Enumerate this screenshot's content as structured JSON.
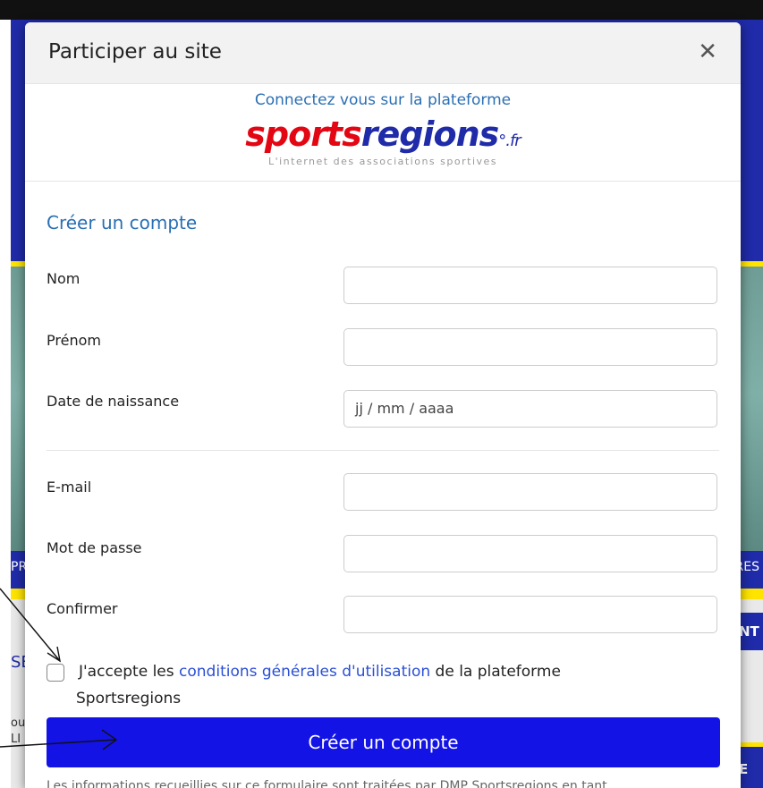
{
  "background": {
    "nav_left": "PR",
    "nav_right": "RES",
    "side_right_1": "NT",
    "side_right_2": "E D",
    "left_heading": "SE",
    "left_text_1": "ou",
    "left_text_2": "LI"
  },
  "modal": {
    "title": "Participer au site",
    "close_icon": "close-icon",
    "brand": {
      "connect_text": "Connectez vous sur la plateforme",
      "logo_part1": "sports",
      "logo_part2": "regions",
      "logo_suffix": "°.fr",
      "tagline": "L'internet des associations sportives"
    },
    "form": {
      "section_title": "Créer un compte",
      "fields": [
        {
          "label": "Nom",
          "value": "",
          "placeholder": ""
        },
        {
          "label": "Prénom",
          "value": "",
          "placeholder": ""
        },
        {
          "label": "Date de naissance",
          "value": "",
          "placeholder": "jj / mm / aaaa"
        },
        {
          "label": "E-mail",
          "value": "",
          "placeholder": ""
        },
        {
          "label": "Mot de passe",
          "value": "",
          "placeholder": ""
        },
        {
          "label": "Confirmer",
          "value": "",
          "placeholder": ""
        }
      ],
      "accept_prefix": "J'accepte les",
      "accept_link": "conditions générales d'utilisation",
      "accept_suffix": "de la plateforme",
      "accept_line2": "Sportsregions",
      "accept_checked": false,
      "submit_label": "Créer un compte",
      "footnote": "Les informations recueillies sur ce formulaire sont traitées par DMP Sportsregions en tant"
    }
  },
  "colors": {
    "accent_blue": "#2a6fb3",
    "button_blue": "#1313e6",
    "brand_red": "#e30613",
    "brand_blue": "#1f2ba8"
  }
}
